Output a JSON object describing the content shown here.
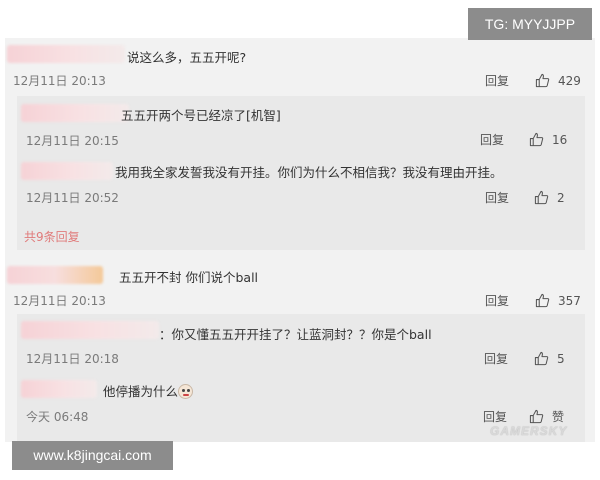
{
  "watermark_tg": "TG: MYYJJPP",
  "watermark_site": "www.k8jingcai.com",
  "watermark_gamersky": "GAMERSKY",
  "reply_label": "回复",
  "icons": {
    "like": "thumbs-up-icon",
    "emoji": "grimace-emoji-icon"
  },
  "comments": [
    {
      "text": "说这么多，五五开呢?",
      "time": "12月11日 20:13",
      "likes": "429",
      "replies": [
        {
          "text": "五五开两个号已经凉了[机智]",
          "time": "12月11日 20:15",
          "likes": "16"
        },
        {
          "text": "我用我全家发誓我没有开挂。你们为什么不相信我？我没有理由开挂。",
          "time": "12月11日 20:52",
          "likes": "2"
        }
      ],
      "more_replies": "共9条回复"
    },
    {
      "text": "五五开不封 你们说个ball",
      "time": "12月11日 20:13",
      "likes": "357",
      "replies": [
        {
          "text": "：你又懂五五开开挂了？让蓝洞封？？你是个ball",
          "time": "12月11日 20:18",
          "likes": "5"
        },
        {
          "text": "他停播为什么",
          "time": "今天 06:48",
          "likes": "赞"
        }
      ]
    }
  ]
}
